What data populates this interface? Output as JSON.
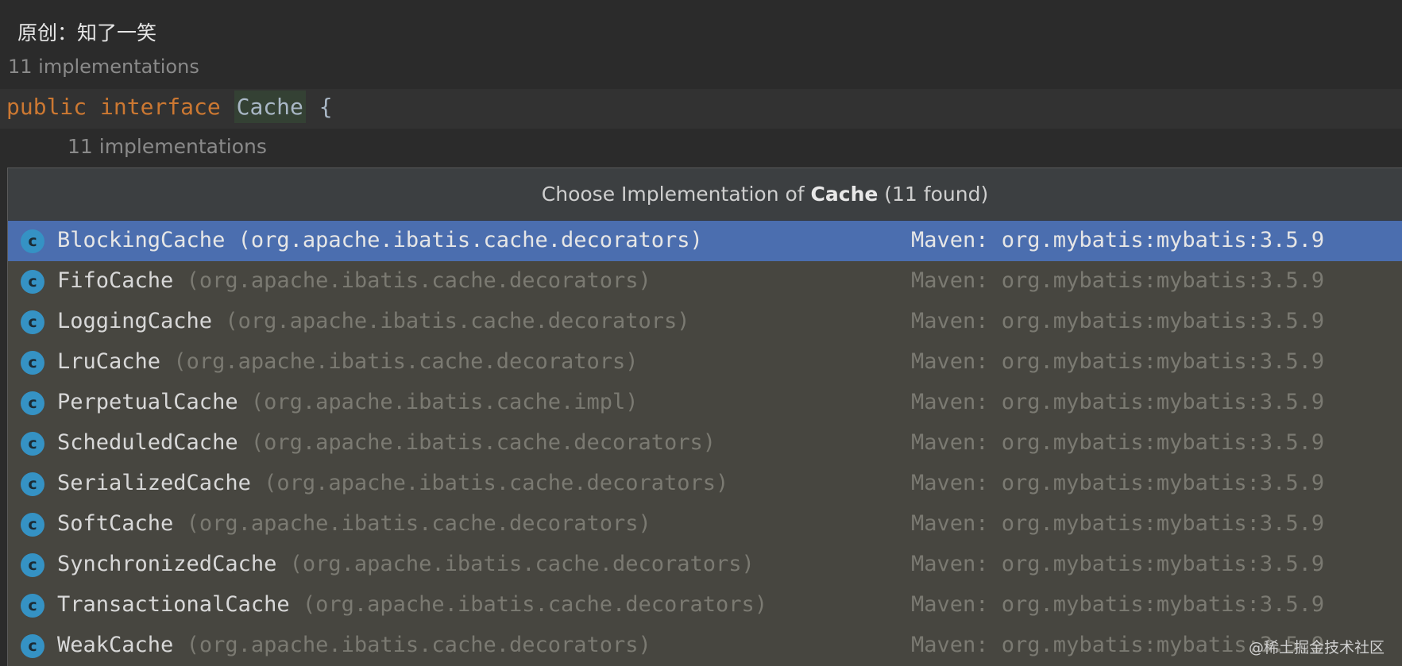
{
  "author_line": "原创：知了一笑",
  "editor": {
    "inlay_hint_top": "11 implementations",
    "code": {
      "kw1": "public",
      "kw2": "interface",
      "class_name": "Cache",
      "brace": "{"
    },
    "inlay_hint_below": "11 implementations"
  },
  "popup": {
    "title_prefix": "Choose Implementation of ",
    "title_bold": "Cache",
    "title_suffix": " (11 found)",
    "icon_letter": "c",
    "items": [
      {
        "name": "BlockingCache",
        "package": "(org.apache.ibatis.cache.decorators)",
        "library": "Maven: org.mybatis:mybatis:3.5.9",
        "selected": true
      },
      {
        "name": "FifoCache",
        "package": "(org.apache.ibatis.cache.decorators)",
        "library": "Maven: org.mybatis:mybatis:3.5.9"
      },
      {
        "name": "LoggingCache",
        "package": "(org.apache.ibatis.cache.decorators)",
        "library": "Maven: org.mybatis:mybatis:3.5.9"
      },
      {
        "name": "LruCache",
        "package": "(org.apache.ibatis.cache.decorators)",
        "library": "Maven: org.mybatis:mybatis:3.5.9"
      },
      {
        "name": "PerpetualCache",
        "package": "(org.apache.ibatis.cache.impl)",
        "library": "Maven: org.mybatis:mybatis:3.5.9"
      },
      {
        "name": "ScheduledCache",
        "package": "(org.apache.ibatis.cache.decorators)",
        "library": "Maven: org.mybatis:mybatis:3.5.9"
      },
      {
        "name": "SerializedCache",
        "package": "(org.apache.ibatis.cache.decorators)",
        "library": "Maven: org.mybatis:mybatis:3.5.9"
      },
      {
        "name": "SoftCache",
        "package": "(org.apache.ibatis.cache.decorators)",
        "library": "Maven: org.mybatis:mybatis:3.5.9"
      },
      {
        "name": "SynchronizedCache",
        "package": "(org.apache.ibatis.cache.decorators)",
        "library": "Maven: org.mybatis:mybatis:3.5.9"
      },
      {
        "name": "TransactionalCache",
        "package": "(org.apache.ibatis.cache.decorators)",
        "library": "Maven: org.mybatis:mybatis:3.5.9"
      },
      {
        "name": "WeakCache",
        "package": "(org.apache.ibatis.cache.decorators)",
        "library": "Maven: org.mybatis:mybatis:3.5.9"
      }
    ]
  },
  "watermark": "@稀土掘金技术社区",
  "colors": {
    "selection": "#4b6eaf",
    "class_icon": "#3592c4",
    "keyword": "#cc7832"
  }
}
